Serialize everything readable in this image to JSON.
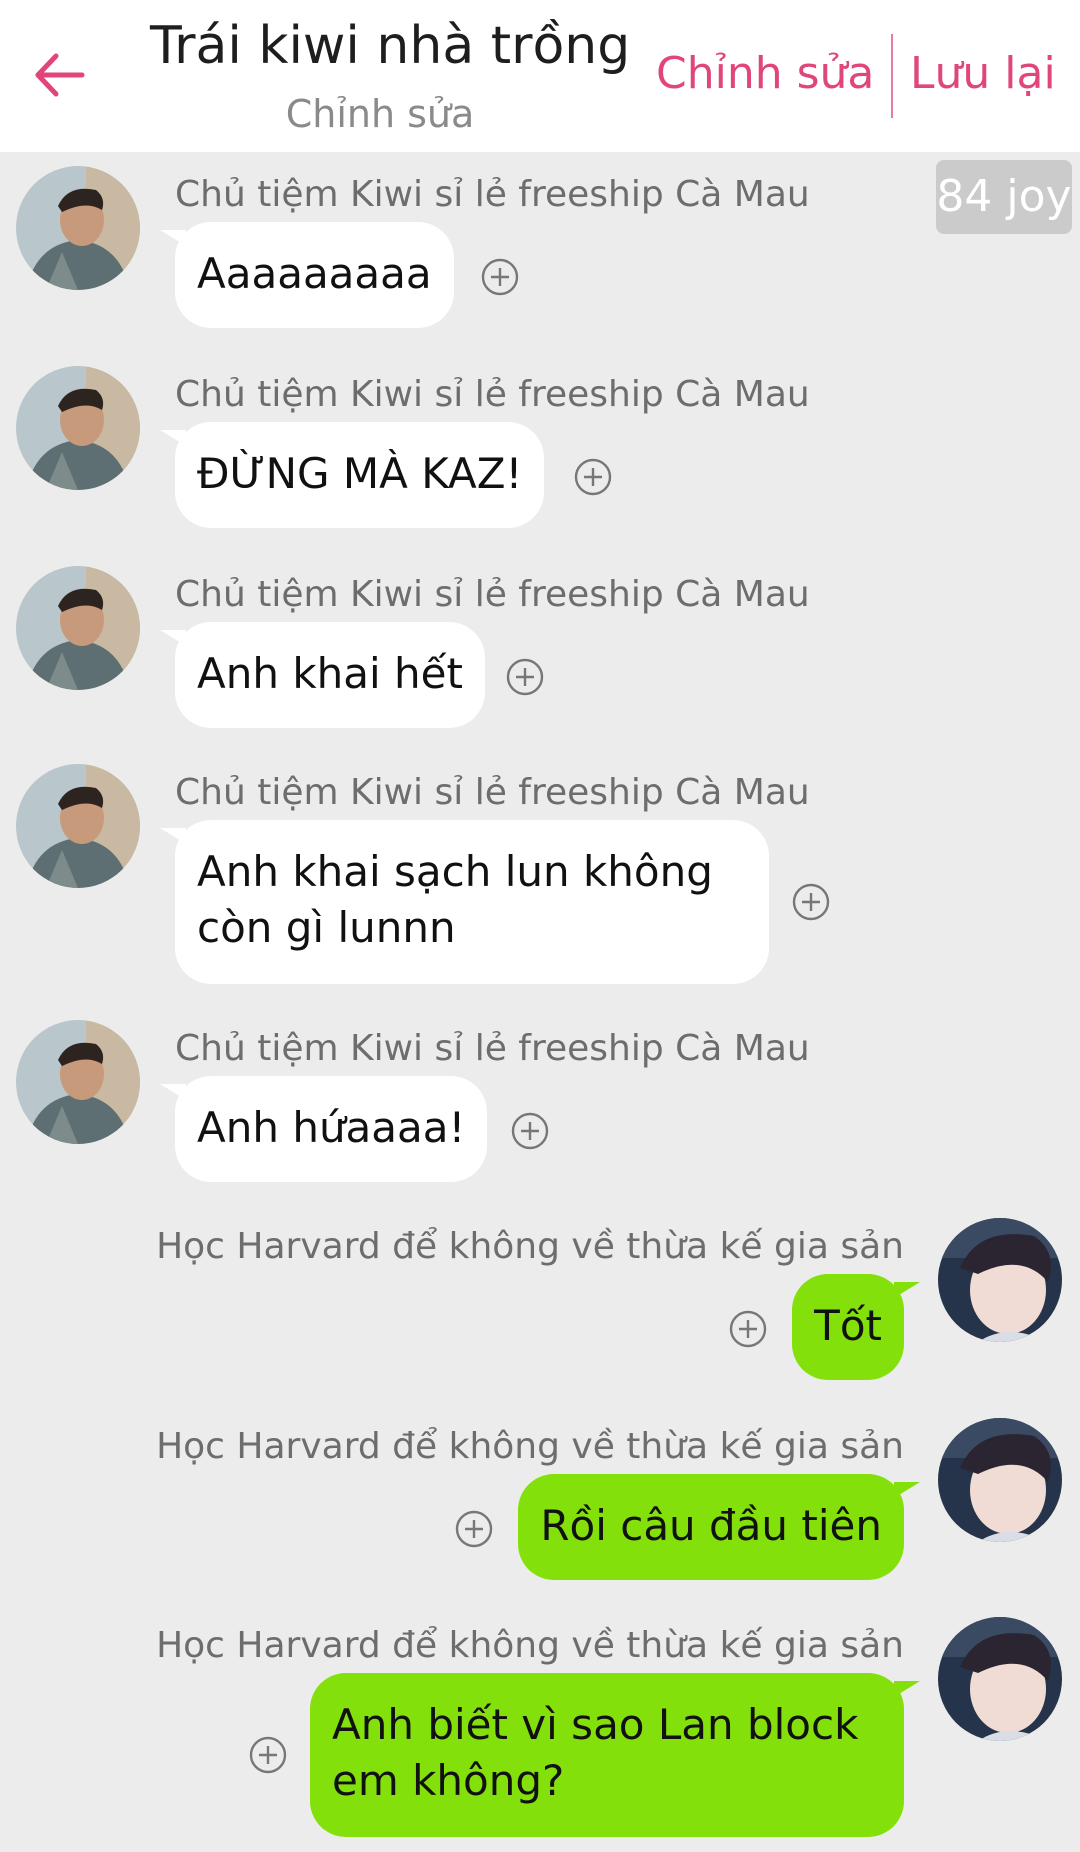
{
  "header": {
    "title": "Trái kiwi nhà trồng",
    "subtitle": "Chỉnh sửa",
    "edit_label": "Chỉnh sửa",
    "save_label": "Lưu lại",
    "accent_color": "#e0457b"
  },
  "badge": {
    "text": "84 joy"
  },
  "incoming_bubble_color": "#ffffff",
  "outgoing_bubble_color": "#84e00a",
  "messages": [
    {
      "sender": "Chủ tiệm Kiwi sỉ lẻ freeship Cà Mau",
      "text": "Aaaaaaaaa"
    },
    {
      "sender": "Chủ tiệm Kiwi sỉ lẻ freeship Cà Mau",
      "text": "ĐỪNG MÀ KAZ!"
    },
    {
      "sender": "Chủ tiệm Kiwi sỉ lẻ freeship Cà Mau",
      "text": "Anh khai hết"
    },
    {
      "sender": "Chủ tiệm Kiwi sỉ lẻ freeship Cà Mau",
      "text_line1": "Anh khai sạch lun không",
      "text_line2": "còn gì lunnn"
    },
    {
      "sender": "Chủ tiệm Kiwi sỉ lẻ freeship Cà Mau",
      "text": "Anh hứaaaa!"
    },
    {
      "sender": "Học Harvard để không về thừa kế gia sản",
      "text": "Tốt"
    },
    {
      "sender": "Học Harvard để không về thừa kế gia sản",
      "text": "Rồi câu đầu tiên"
    },
    {
      "sender": "Học Harvard để không về thừa kế gia sản",
      "text_line1": "Anh biết vì sao Lan block",
      "text_line2": "em không?"
    }
  ]
}
